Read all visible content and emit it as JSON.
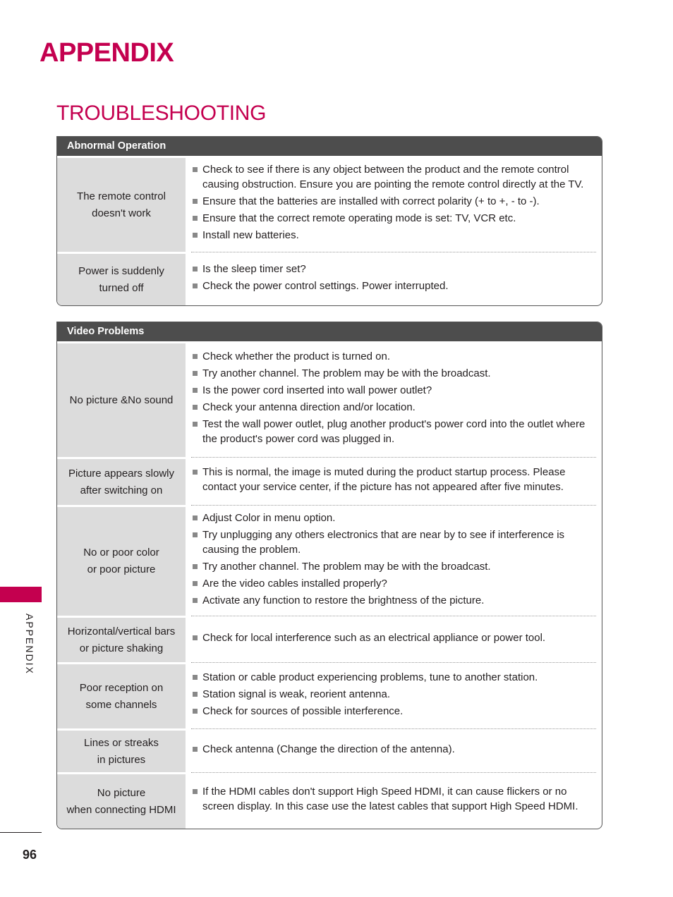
{
  "header": {
    "page_title": "APPENDIX",
    "section_title": "TROUBLESHOOTING"
  },
  "colors": {
    "accent": "#c4004f",
    "table_header": "#4d4d4d",
    "cause_cell": "#dcdcdc",
    "bullet": "#888888"
  },
  "tables": [
    {
      "title": "Abnormal Operation",
      "rows": [
        {
          "cause": [
            "The remote control",
            "doesn't work"
          ],
          "solutions": [
            "Check to see if there is any object between the product and the remote control causing obstruction. Ensure you are pointing the remote control directly at the TV.",
            "Ensure that the batteries are installed with correct polarity (+ to +, - to -).",
            "Ensure that the correct remote operating mode is set: TV, VCR etc.",
            "Install new batteries."
          ]
        },
        {
          "cause": [
            "Power is suddenly",
            "turned off"
          ],
          "solutions": [
            "Is the sleep timer set?",
            "Check the power control settings. Power interrupted."
          ]
        }
      ]
    },
    {
      "title": "Video Problems",
      "rows": [
        {
          "cause": [
            "No picture &No sound"
          ],
          "solutions": [
            "Check whether the product is turned on.",
            "Try another channel. The problem may be with the broadcast.",
            "Is the power cord inserted into wall power outlet?",
            "Check your antenna direction and/or location.",
            "Test the wall power outlet, plug another product's power cord into the outlet where the product's power cord was plugged in."
          ]
        },
        {
          "cause": [
            "Picture appears slowly",
            "after switching on"
          ],
          "solutions": [
            "This is normal, the image is muted during the product startup process. Please contact your service center, if the picture has not appeared after five minutes."
          ]
        },
        {
          "cause": [
            "No or poor color",
            "or poor picture"
          ],
          "solutions": [
            "Adjust Color in menu option.",
            "Try unplugging any others electronics that are near by to see if interference is causing the problem.",
            "Try another channel. The problem may be with the broadcast.",
            "Are the video cables installed properly?",
            "Activate any function to restore the brightness of the picture."
          ]
        },
        {
          "cause": [
            "Horizontal/vertical bars",
            "or picture shaking"
          ],
          "solutions": [
            "Check for local interference such as an electrical appliance or power tool."
          ]
        },
        {
          "cause": [
            "Poor reception on",
            "some channels"
          ],
          "solutions": [
            "Station or cable product experiencing problems, tune to another station.",
            "Station signal is weak, reorient antenna.",
            "Check for sources of possible interference."
          ]
        },
        {
          "cause": [
            "Lines or streaks",
            "in pictures"
          ],
          "solutions": [
            "Check antenna (Change the direction of the antenna)."
          ]
        },
        {
          "cause": [
            "No picture",
            "when connecting HDMI"
          ],
          "solutions": [
            "If the HDMI cables don't support High Speed HDMI, it can cause flickers or no screen display. In this case use the latest cables that support High Speed HDMI."
          ]
        }
      ]
    }
  ],
  "sidebar": {
    "label": "APPENDIX"
  },
  "footer": {
    "page_number": "96"
  }
}
